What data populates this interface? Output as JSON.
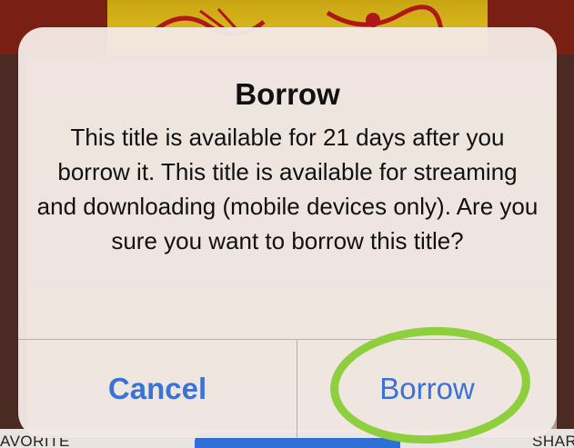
{
  "background": {
    "left_label": "AVORITE",
    "right_label": "SHAR"
  },
  "alert": {
    "title": "Borrow",
    "message": "This title is available for 21 days after you borrow it.  This title is available for streaming and downloading (mobile devices only). Are you sure you want to borrow this title?",
    "cancel_label": "Cancel",
    "confirm_label": "Borrow"
  },
  "colors": {
    "button_text": "#3a73d6",
    "highlight": "#8dcf3c"
  }
}
